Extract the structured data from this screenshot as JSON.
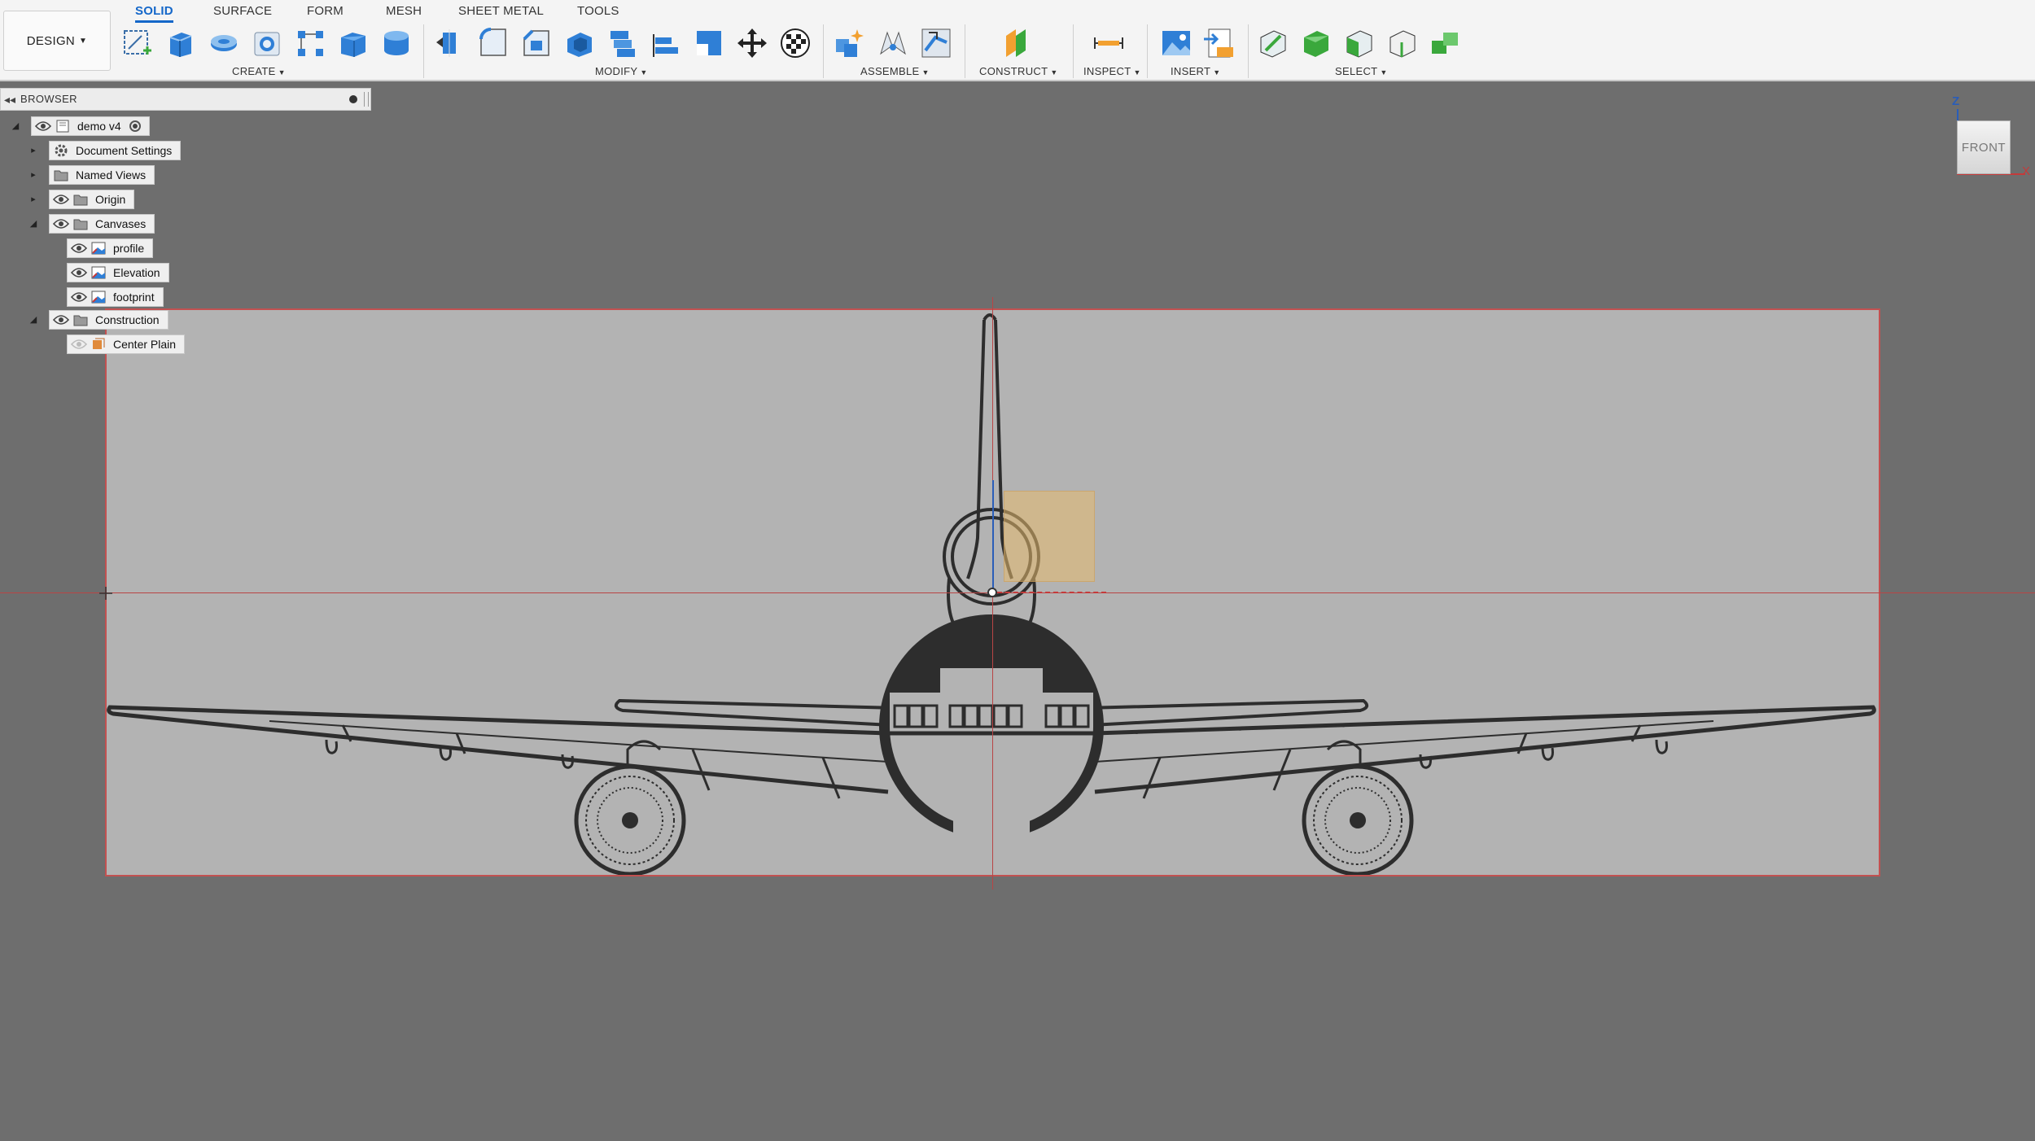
{
  "toolbar": {
    "workspace_label": "DESIGN",
    "tabs": [
      "SOLID",
      "SURFACE",
      "FORM",
      "MESH",
      "SHEET METAL",
      "TOOLS"
    ],
    "active_tab": "SOLID",
    "groups": {
      "create": "CREATE",
      "modify": "MODIFY",
      "assemble": "ASSEMBLE",
      "construct": "CONSTRUCT",
      "inspect": "INSPECT",
      "insert": "INSERT",
      "select": "SELECT"
    }
  },
  "browser": {
    "title": "BROWSER",
    "root": "demo v4",
    "items": [
      {
        "label": "Document Settings"
      },
      {
        "label": "Named Views"
      },
      {
        "label": "Origin"
      },
      {
        "label": "Canvases"
      },
      {
        "label": "profile"
      },
      {
        "label": "Elevation"
      },
      {
        "label": "footprint"
      },
      {
        "label": "Construction"
      },
      {
        "label": "Center Plain"
      }
    ]
  },
  "viewcube": {
    "face": "FRONT",
    "z_label": "Z",
    "x_label": "X"
  },
  "colors": {
    "accent": "#1467c9",
    "axis_red": "#b84545",
    "axis_blue": "#2a5db8",
    "canvas_bg": "#b3b3b3",
    "viewport_bg": "#6e6e6e",
    "plane": "#e6b96e"
  },
  "icons": [
    "new-component-icon",
    "create-sketch-icon",
    "extrude-icon",
    "revolve-icon",
    "hole-icon",
    "pattern-icon",
    "box-icon",
    "cylinder-icon",
    "press-pull-icon",
    "fillet-icon",
    "chamfer-icon",
    "shell-icon",
    "combine-icon",
    "align-icon",
    "scale-icon",
    "move-icon",
    "appearance-icon",
    "new-component-assembly-icon",
    "joint-icon",
    "as-built-joint-icon",
    "offset-plane-icon",
    "measure-icon",
    "insert-image-icon",
    "insert-svg-icon",
    "select-icon",
    "eye-icon",
    "folder-icon",
    "gear-icon",
    "canvas-icon",
    "plane-icon",
    "radio-icon"
  ]
}
